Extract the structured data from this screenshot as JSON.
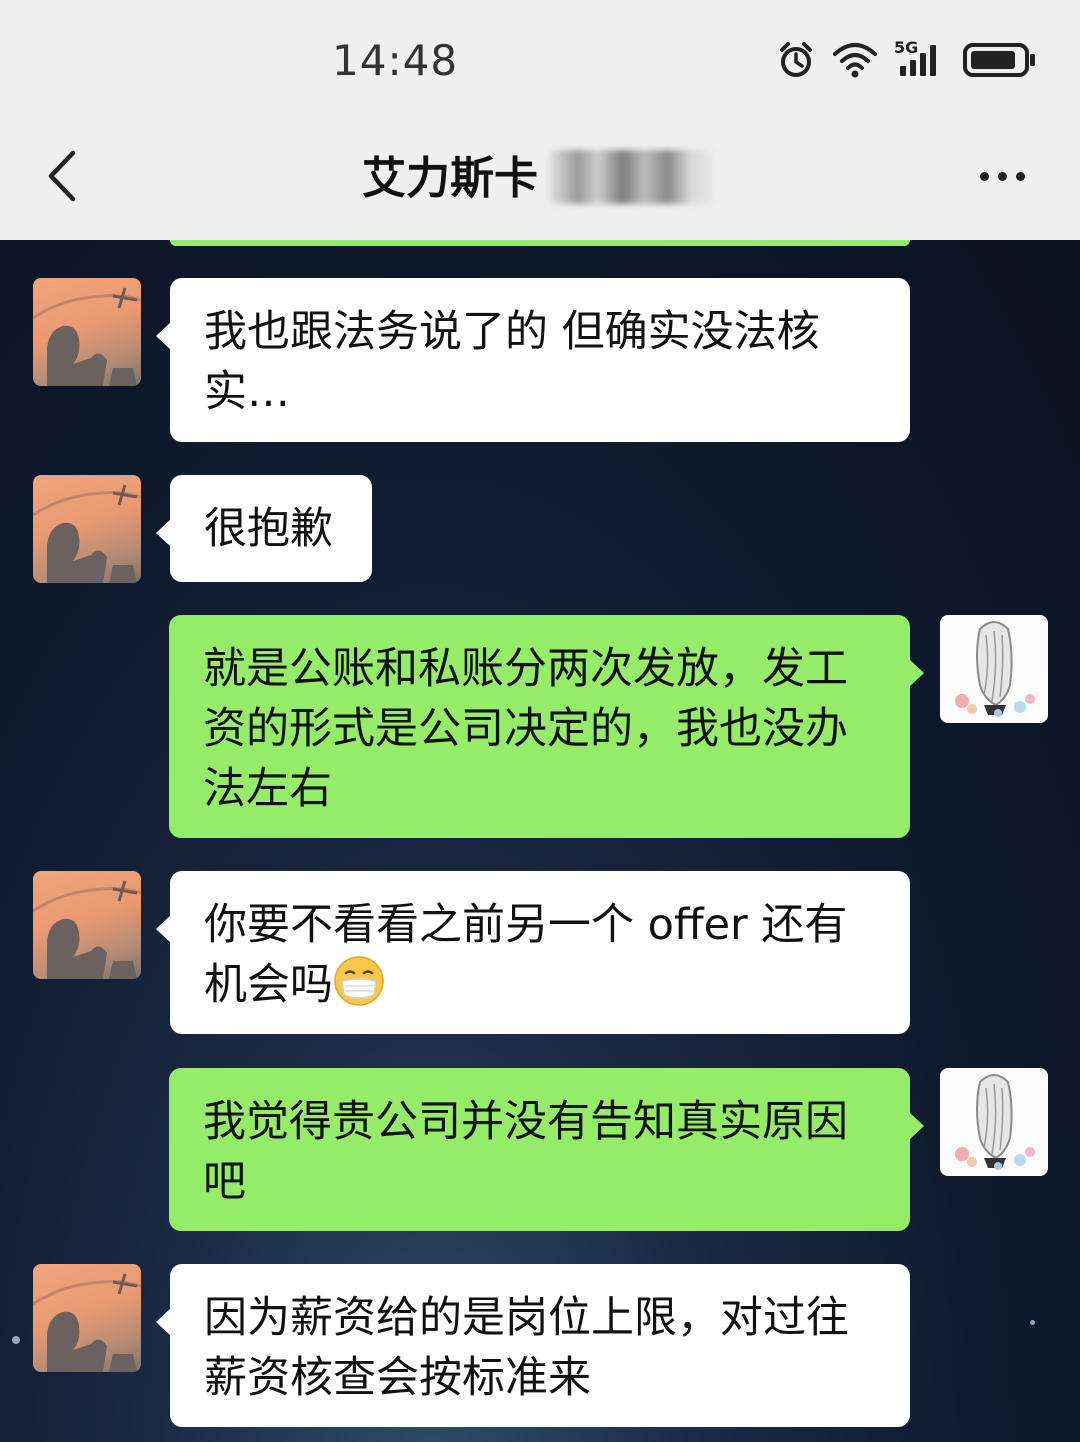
{
  "status_bar": {
    "time": "14:48",
    "icons": [
      "alarm-icon",
      "wifi-icon",
      "5g-signal-icon",
      "battery-icon"
    ],
    "network_label": "5G"
  },
  "header": {
    "back_icon": "chevron-left-icon",
    "title": "艾力斯卡",
    "more_icon": "more-dots-icon"
  },
  "colors": {
    "header_bg": "#efefef",
    "incoming_bubble": "#ffffff",
    "outgoing_bubble": "#95ec69",
    "chat_bg": "#0c1424"
  },
  "messages": [
    {
      "side": "in",
      "line1": "我也跟法务说了的 但确实没法核",
      "line2": "实…"
    },
    {
      "side": "in",
      "line1": "很抱歉"
    },
    {
      "side": "out",
      "line1": "就是公账和私账分两次发放，发工",
      "line2": "资的形式是公司决定的，我也没办",
      "line3": "法左右"
    },
    {
      "side": "in",
      "line1": "你要不看看之前另一个 offer 还有",
      "line2": "机会吗",
      "emoji": "mask-face-emoji"
    },
    {
      "side": "out",
      "line1": "我觉得贵公司并没有告知真实原因",
      "line2": "吧"
    },
    {
      "side": "in",
      "line1": "因为薪资给的是岗位上限，对过往",
      "line2": "薪资核查会按标准来"
    }
  ]
}
